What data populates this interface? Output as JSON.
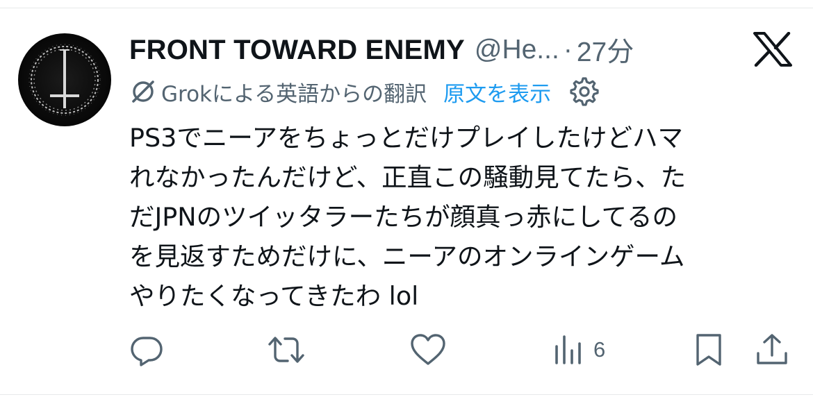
{
  "tweet": {
    "author_name": "FRONT TOWARD ENEMY",
    "handle": "@He...",
    "separator": "·",
    "time": "27分",
    "translation_label": "Grokによる英語からの翻訳",
    "show_original_label": "原文を表示",
    "body_lines": [
      "PS3でニーアをちょっとだけプレイしたけどハマ",
      "れなかったんだけど、正直この騒動見てたら、た",
      "だJPNのツイッタラーたちが顔真っ赤にしてるの",
      "を見返すためだけに、ニーアのオンラインゲーム",
      "やりたくなってきたわ lol"
    ]
  },
  "actions": {
    "views_count": "6"
  },
  "icons": {
    "platform": "x-logo-icon",
    "translation": "grok-icon",
    "settings": "gear-icon",
    "reply": "reply-icon",
    "repost": "repost-icon",
    "like": "heart-icon",
    "views": "views-icon",
    "bookmark": "bookmark-icon",
    "share": "share-icon"
  },
  "colors": {
    "text": "#0f1419",
    "secondary": "#536471",
    "link": "#1d9bf0"
  }
}
